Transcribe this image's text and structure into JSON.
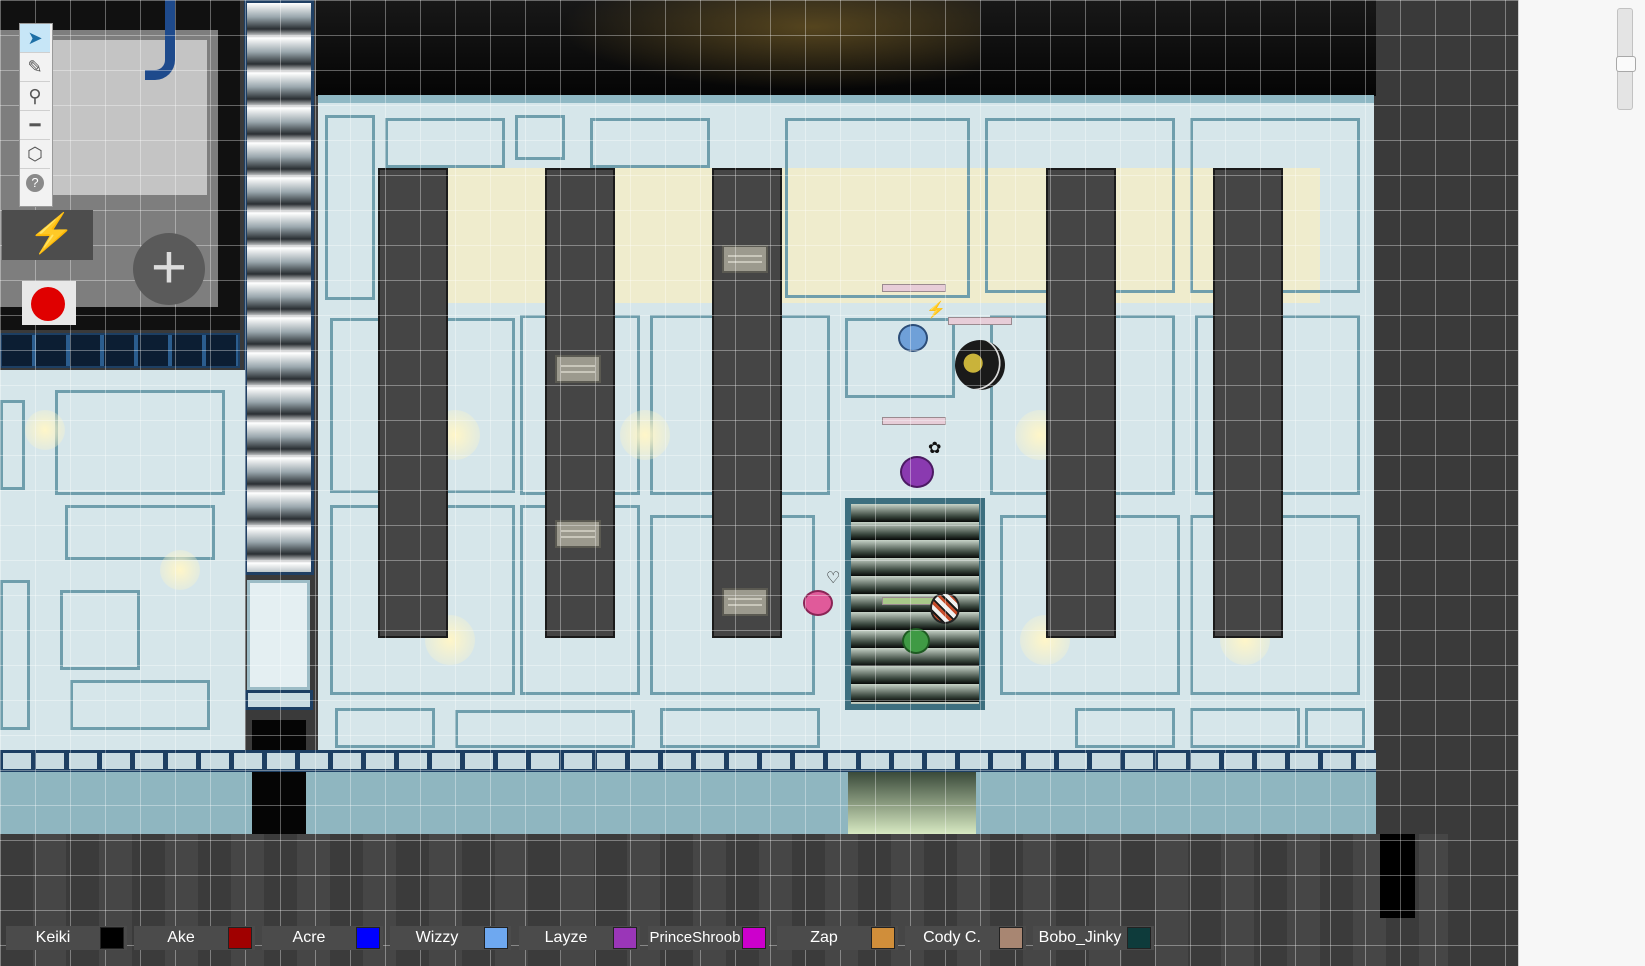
{
  "app": {
    "type": "virtual-tabletop",
    "scene": "tactical grid map"
  },
  "toolbar": {
    "tools": [
      {
        "name": "select",
        "icon": "arrow-cursor-icon",
        "active": true
      },
      {
        "name": "draw",
        "icon": "brush-icon",
        "active": false
      },
      {
        "name": "zoom",
        "icon": "magnifier-icon",
        "active": false
      },
      {
        "name": "measure",
        "icon": "ruler-icon",
        "active": false
      },
      {
        "name": "dice",
        "icon": "dice-icon",
        "active": false
      },
      {
        "name": "help",
        "icon": "question-icon",
        "active": false
      }
    ]
  },
  "macro": {
    "icon": "lightning-bolt-icon"
  },
  "record": {
    "icon": "record-dot-icon",
    "color": "#e00000"
  },
  "add": {
    "label": "+"
  },
  "players": [
    {
      "name": "Keiki",
      "color": "#000000"
    },
    {
      "name": "Ake",
      "color": "#a00000"
    },
    {
      "name": "Acre",
      "color": "#0000ff"
    },
    {
      "name": "Wizzy",
      "color": "#6ea8f0"
    },
    {
      "name": "Layze",
      "color": "#9a36b8"
    },
    {
      "name": "PrinceShroob",
      "color": "#cc00cc"
    },
    {
      "name": "Zap",
      "color": "#d08e3a"
    },
    {
      "name": "Cody C.",
      "color": "#a88672"
    },
    {
      "name": "Bobo_Jinky",
      "color": "#0e3b3b"
    }
  ],
  "tokens": [
    {
      "name": "armored-rider-token",
      "color": "#1a1a1a"
    },
    {
      "name": "blue-creature-token",
      "color": "#6fa0d8"
    },
    {
      "name": "purple-creature-token",
      "color": "#8a3ab0"
    },
    {
      "name": "pink-creature-token",
      "color": "#e05a9a"
    },
    {
      "name": "striped-creature-token",
      "color": "#e8e8e8"
    },
    {
      "name": "green-creature-token",
      "color": "#3f9a44"
    }
  ],
  "zoom": {
    "level": 0.55
  }
}
